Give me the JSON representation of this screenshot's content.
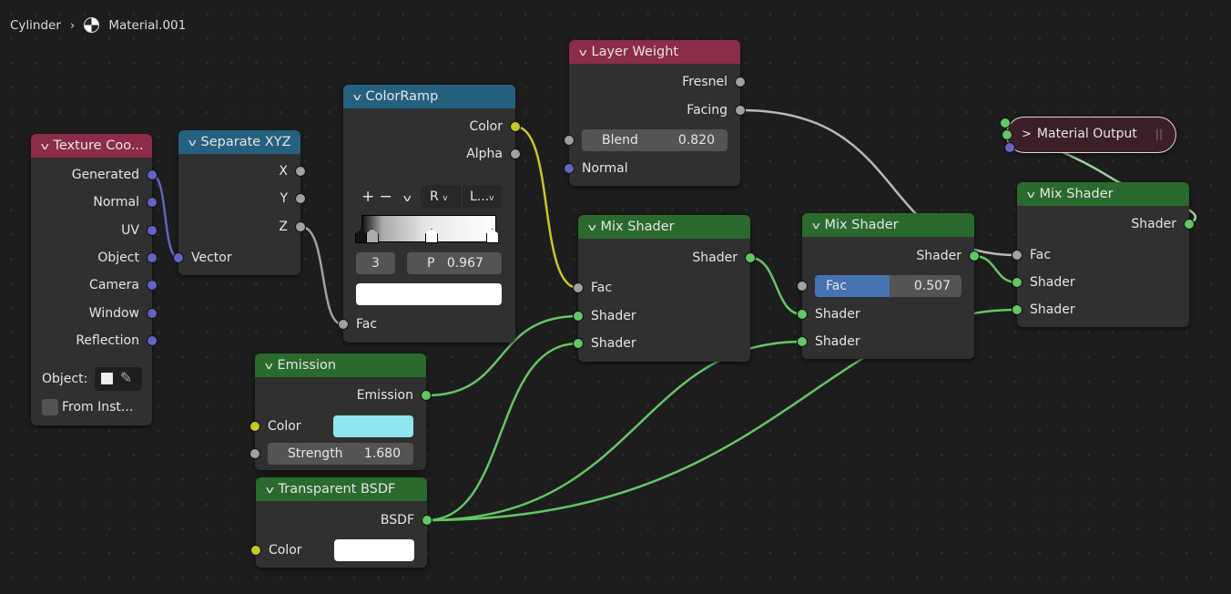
{
  "breadcrumb": {
    "object": "Cylinder",
    "material": "Material.001"
  },
  "colors": {
    "socket_vector": "#6363c7",
    "socket_float": "#a1a1a1",
    "socket_color": "#c7c729",
    "socket_shader": "#63c763",
    "header_input": "#8b2c48",
    "header_converter": "#25617f",
    "header_shader": "#2a6a2c"
  },
  "texcoord": {
    "title": "Texture Coo...",
    "outputs": [
      "Generated",
      "Normal",
      "UV",
      "Object",
      "Camera",
      "Window",
      "Reflection"
    ],
    "object_label": "Object:",
    "from_instancer": "From Inst..."
  },
  "separate": {
    "title": "Separate XYZ",
    "outputs": [
      "X",
      "Y",
      "Z"
    ],
    "input": "Vector"
  },
  "colorramp": {
    "title": "ColorRamp",
    "outputs": [
      "Color",
      "Alpha"
    ],
    "add": "+",
    "remove": "−",
    "color_mode": "R",
    "interpolation": "L...",
    "active_index": "3",
    "pos_label": "P",
    "pos_value": "0.967",
    "input": "Fac",
    "stops": [
      0,
      0.08,
      0.52,
      0.97
    ]
  },
  "layerweight": {
    "title": "Layer Weight",
    "outputs": [
      "Fresnel",
      "Facing"
    ],
    "blend_label": "Blend",
    "blend_value": "0.820",
    "input": "Normal"
  },
  "mix1": {
    "title": "Mix Shader",
    "output": "Shader",
    "inputs": [
      "Fac",
      "Shader",
      "Shader"
    ]
  },
  "mix2": {
    "title": "Mix Shader",
    "output": "Shader",
    "fac_label": "Fac",
    "fac_value": "0.507",
    "fac": 0.507,
    "inputs": [
      "Shader",
      "Shader"
    ]
  },
  "mix3": {
    "title": "Mix Shader",
    "output": "Shader",
    "inputs": [
      "Fac",
      "Shader",
      "Shader"
    ]
  },
  "output": {
    "title": "Material Output"
  },
  "emission": {
    "title": "Emission",
    "output": "Emission",
    "color_label": "Color",
    "color": "#8fe6ee",
    "strength_label": "Strength",
    "strength_value": "1.680"
  },
  "transparent": {
    "title": "Transparent BSDF",
    "output": "BSDF",
    "color_label": "Color",
    "color": "#ffffff"
  }
}
